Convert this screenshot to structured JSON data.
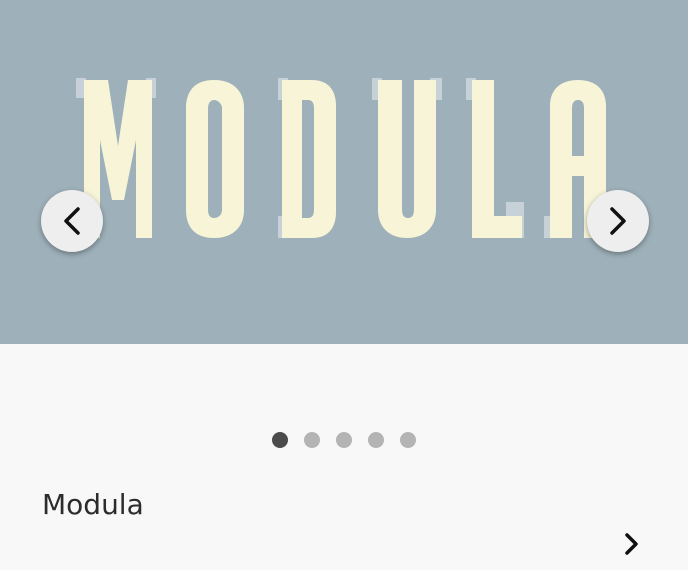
{
  "hero": {
    "wordmark_text": "MODULA",
    "background_color": "#9eb1ba",
    "letter_color": "#f8f5d8",
    "shadow_color": "#cfd7de"
  },
  "carousel": {
    "prev_icon": "chevron-left-icon",
    "next_icon": "chevron-right-icon",
    "total_slides": 5,
    "active_index": 0
  },
  "item": {
    "title": "Modula",
    "chevron_icon": "chevron-right-icon"
  }
}
